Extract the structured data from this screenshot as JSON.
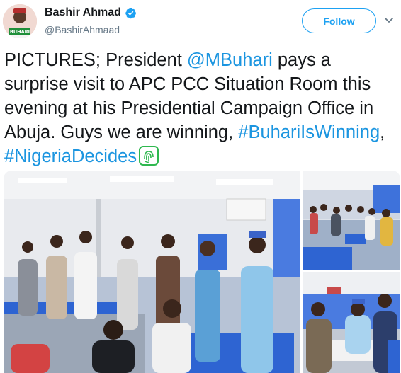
{
  "tweet": {
    "author_name": "Bashir Ahmad",
    "author_handle": "@BashirAhmaad",
    "verified": true,
    "follow_label": "Follow",
    "avatar_badge_text": "BUHARI",
    "text": {
      "part1": "PICTURES; President ",
      "mention": "@MBuhari",
      "part2": " pays a surprise visit to APC PCC Situation Room this evening at his Presidential Campaign Office in Abuja. Guys we are winning, ",
      "hashtag1": "#BuhariIsWinning",
      "sep": ", ",
      "hashtag2": "#NigeriaDecides"
    },
    "emoji": "fingerprint-emoji"
  },
  "colors": {
    "accent": "#1da1f2",
    "link": "#1b95e0",
    "text": "#14171a",
    "secondary": "#657786"
  },
  "media": {
    "photos": [
      {
        "label": "President in situation room with staff at computers"
      },
      {
        "label": "Wide view of situation room staff"
      },
      {
        "label": "President seated at desk with officials"
      }
    ]
  }
}
